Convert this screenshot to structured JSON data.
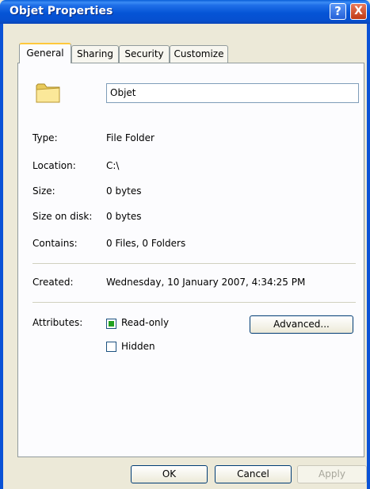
{
  "window": {
    "title": "Objet Properties",
    "help_glyph": "?",
    "close_glyph": "X"
  },
  "tabs": [
    {
      "label": "General",
      "active": true
    },
    {
      "label": "Sharing",
      "active": false
    },
    {
      "label": "Security",
      "active": false
    },
    {
      "label": "Customize",
      "active": false
    }
  ],
  "general": {
    "icon": "folder-icon",
    "name_value": "Objet",
    "type_label": "Type:",
    "type_value": "File Folder",
    "location_label": "Location:",
    "location_value": "C:\\",
    "size_label": "Size:",
    "size_value": "0 bytes",
    "size_on_disk_label": "Size on disk:",
    "size_on_disk_value": "0 bytes",
    "contains_label": "Contains:",
    "contains_value": "0 Files, 0 Folders",
    "created_label": "Created:",
    "created_value": "Wednesday, 10 January 2007, 4:34:25 PM",
    "attributes_label": "Attributes:",
    "readonly_label": "Read-only",
    "readonly_state": "indeterminate",
    "hidden_label": "Hidden",
    "hidden_checked": false,
    "advanced_label": "Advanced..."
  },
  "footer": {
    "ok_label": "OK",
    "cancel_label": "Cancel",
    "apply_label": "Apply"
  },
  "colors": {
    "titlebar": "#0554d6",
    "dialog_bg": "#ece9d8",
    "panel_bg": "#fcfcfe",
    "tab_highlight": "#ffc83c",
    "readonly_mark": "#21a121"
  }
}
